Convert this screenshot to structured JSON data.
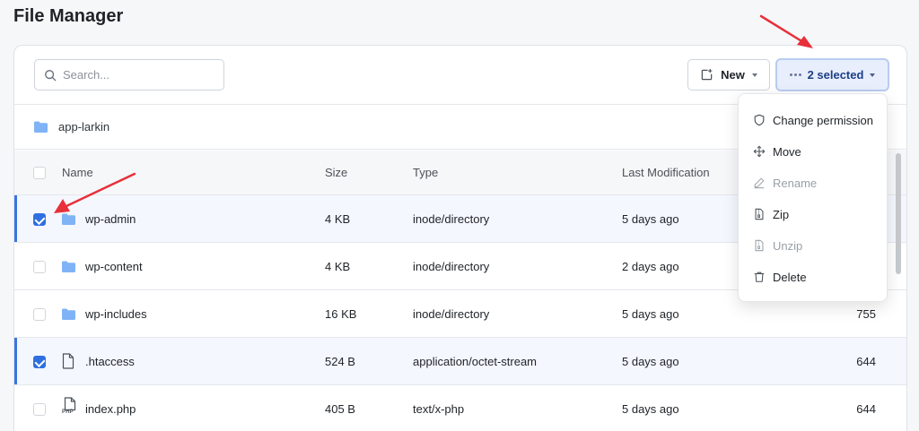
{
  "page_title": "File Manager",
  "search": {
    "placeholder": "Search..."
  },
  "toolbar": {
    "new_label": "New",
    "selected_label": "2 selected"
  },
  "breadcrumb": {
    "folder": "app-larkin"
  },
  "columns": {
    "name": "Name",
    "size": "Size",
    "type": "Type",
    "last_modification": "Last Modification"
  },
  "rows": [
    {
      "name": "wp-admin",
      "size": "4 KB",
      "type": "inode/directory",
      "modified": "5 days ago",
      "permission": "",
      "icon": "folder-icon",
      "checked": true
    },
    {
      "name": "wp-content",
      "size": "4 KB",
      "type": "inode/directory",
      "modified": "2 days ago",
      "permission": "",
      "icon": "folder-icon",
      "checked": false
    },
    {
      "name": "wp-includes",
      "size": "16 KB",
      "type": "inode/directory",
      "modified": "5 days ago",
      "permission": "755",
      "icon": "folder-icon",
      "checked": false
    },
    {
      "name": ".htaccess",
      "size": "524 B",
      "type": "application/octet-stream",
      "modified": "5 days ago",
      "permission": "644",
      "icon": "file-icon",
      "checked": true
    },
    {
      "name": "index.php",
      "size": "405 B",
      "type": "text/x-php",
      "modified": "5 days ago",
      "permission": "644",
      "icon": "php-file-icon",
      "checked": false
    }
  ],
  "php_badge": "PHP",
  "menu": {
    "items": [
      {
        "label": "Change permission",
        "icon": "shield-icon",
        "disabled": false
      },
      {
        "label": "Move",
        "icon": "move-icon",
        "disabled": false
      },
      {
        "label": "Rename",
        "icon": "pencil-icon",
        "disabled": true
      },
      {
        "label": "Zip",
        "icon": "zip-icon",
        "disabled": false
      },
      {
        "label": "Unzip",
        "icon": "unzip-icon",
        "disabled": true
      },
      {
        "label": "Delete",
        "icon": "trash-icon",
        "disabled": false
      }
    ]
  },
  "colors": {
    "accent": "#2f6fe0",
    "folder": "#7fb3f5",
    "annotation_arrow": "#e8303a"
  }
}
